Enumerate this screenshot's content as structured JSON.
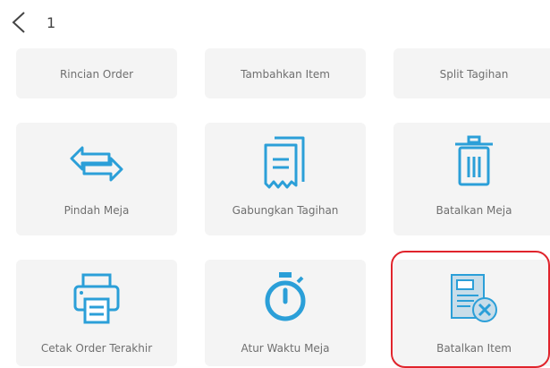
{
  "header": {
    "title": "1"
  },
  "tiles": {
    "rincian_order": {
      "label": "Rincian Order"
    },
    "tambahkan_item": {
      "label": "Tambahkan Item"
    },
    "split_tagihan": {
      "label": "Split Tagihan"
    },
    "pindah_meja": {
      "label": "Pindah Meja",
      "icon": "swap-arrows-icon"
    },
    "gabungkan_tagihan": {
      "label": "Gabungkan Tagihan",
      "icon": "merge-bills-icon"
    },
    "batalkan_meja": {
      "label": "Batalkan Meja",
      "icon": "trash-icon"
    },
    "cetak_order_terakhir": {
      "label": "Cetak Order Terakhir",
      "icon": "printer-icon"
    },
    "atur_waktu_meja": {
      "label": "Atur Waktu Meja",
      "icon": "stopwatch-icon"
    },
    "batalkan_item": {
      "label": "Batalkan Item",
      "icon": "cancel-item-icon"
    }
  },
  "colors": {
    "accent": "#2b9fd8",
    "highlight": "#e0242c",
    "tile_bg": "#f4f4f4"
  }
}
